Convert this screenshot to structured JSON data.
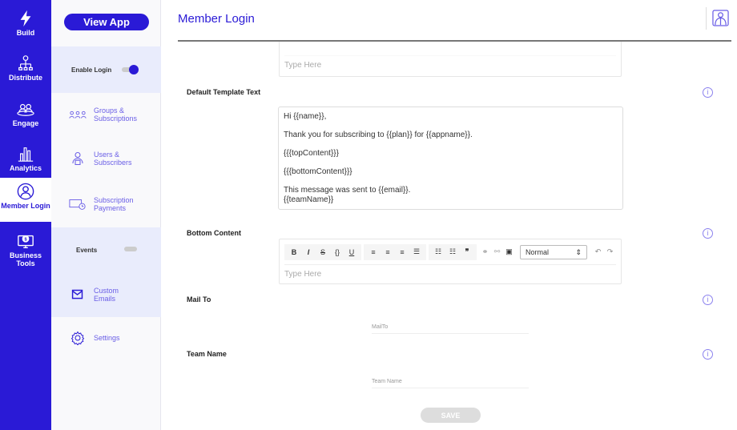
{
  "nav": [
    {
      "label": "Build",
      "icon": "bolt-icon"
    },
    {
      "label": "Distribute",
      "icon": "distribute-icon"
    },
    {
      "label": "Engage",
      "icon": "engage-icon"
    },
    {
      "label": "Analytics",
      "icon": "chart-icon"
    },
    {
      "label": "Member Login",
      "icon": "user-circle-icon",
      "active": true
    },
    {
      "label": "Business Tools",
      "icon": "monitor-dollar-icon"
    }
  ],
  "panel": {
    "view_app": "View App",
    "enable_login": "Enable Login",
    "enable_login_on": true,
    "groups": "Groups & Subscriptions",
    "users": "Users & Subscribers",
    "payments": "Subscription Payments",
    "events": "Events",
    "events_on": false,
    "custom_emails": "Custom Emails",
    "settings": "Settings"
  },
  "header": {
    "title": "Member Login"
  },
  "form": {
    "top_editor_placeholder": "Type Here",
    "default_template_label": "Default Template Text",
    "template_lines": [
      "Hi {{name}},",
      "Thank you for subscribing to {{plan}} for {{appname}}.",
      "{{{topContent}}}",
      "{{{bottomContent}}}",
      "This message was sent to {{email}}.",
      "{{teamName}}"
    ],
    "bottom_content_label": "Bottom Content",
    "format_select": "Normal",
    "bottom_placeholder": "Type Here",
    "mail_to_label": "Mail To",
    "mail_to_placeholder": "MailTo",
    "team_name_label": "Team Name",
    "team_name_placeholder": "Team Name",
    "save": "SAVE"
  },
  "colors": {
    "brand": "#2a1ad6",
    "highlight": "#e9ecfc"
  }
}
